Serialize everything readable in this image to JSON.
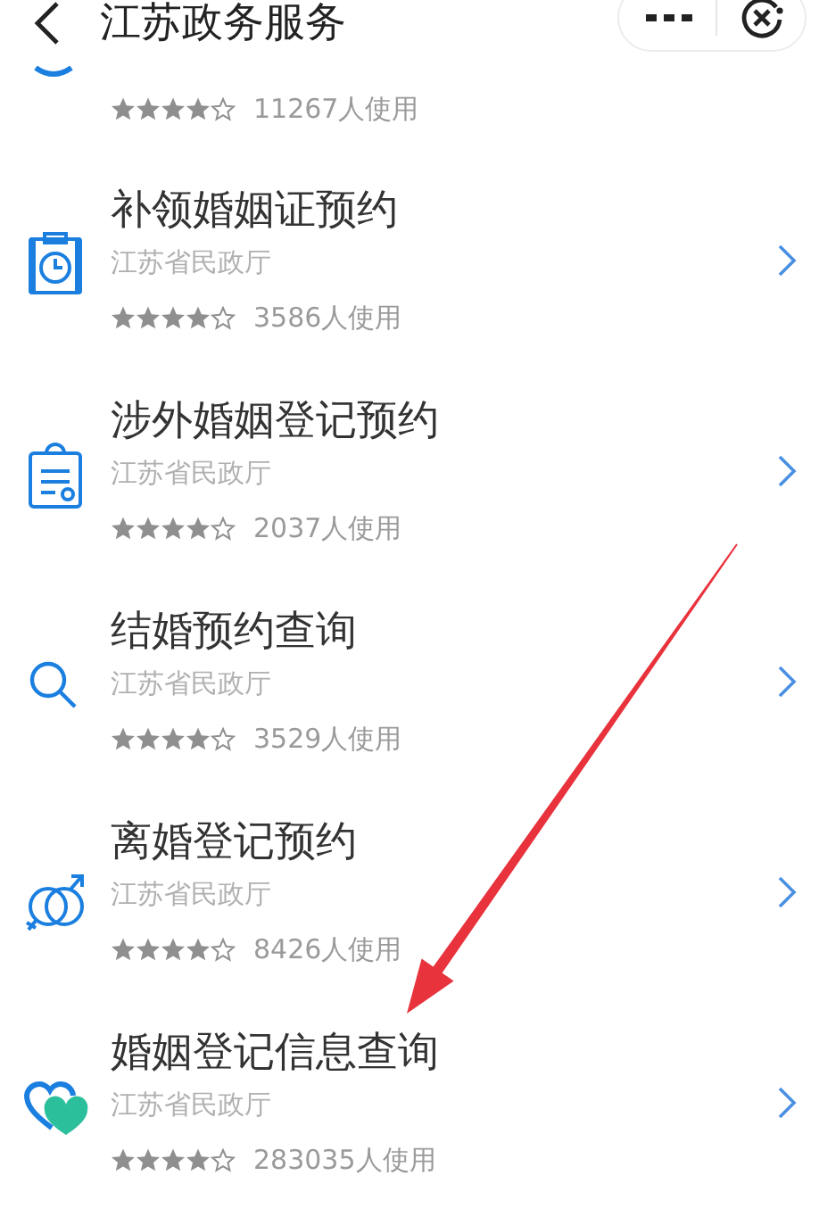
{
  "header": {
    "title": "江苏政务服务"
  },
  "services": [
    {
      "stars": 4,
      "users": "11267人使用"
    },
    {
      "title": "补领婚姻证预约",
      "department": "江苏省民政厅",
      "stars": 4,
      "users": "3586人使用"
    },
    {
      "title": "涉外婚姻登记预约",
      "department": "江苏省民政厅",
      "stars": 4,
      "users": "2037人使用"
    },
    {
      "title": "结婚预约查询",
      "department": "江苏省民政厅",
      "stars": 4,
      "users": "3529人使用"
    },
    {
      "title": "离婚登记预约",
      "department": "江苏省民政厅",
      "stars": 4,
      "users": "8426人使用"
    },
    {
      "title": "婚姻登记信息查询",
      "department": "江苏省民政厅",
      "stars": 4,
      "users": "283035人使用"
    }
  ]
}
